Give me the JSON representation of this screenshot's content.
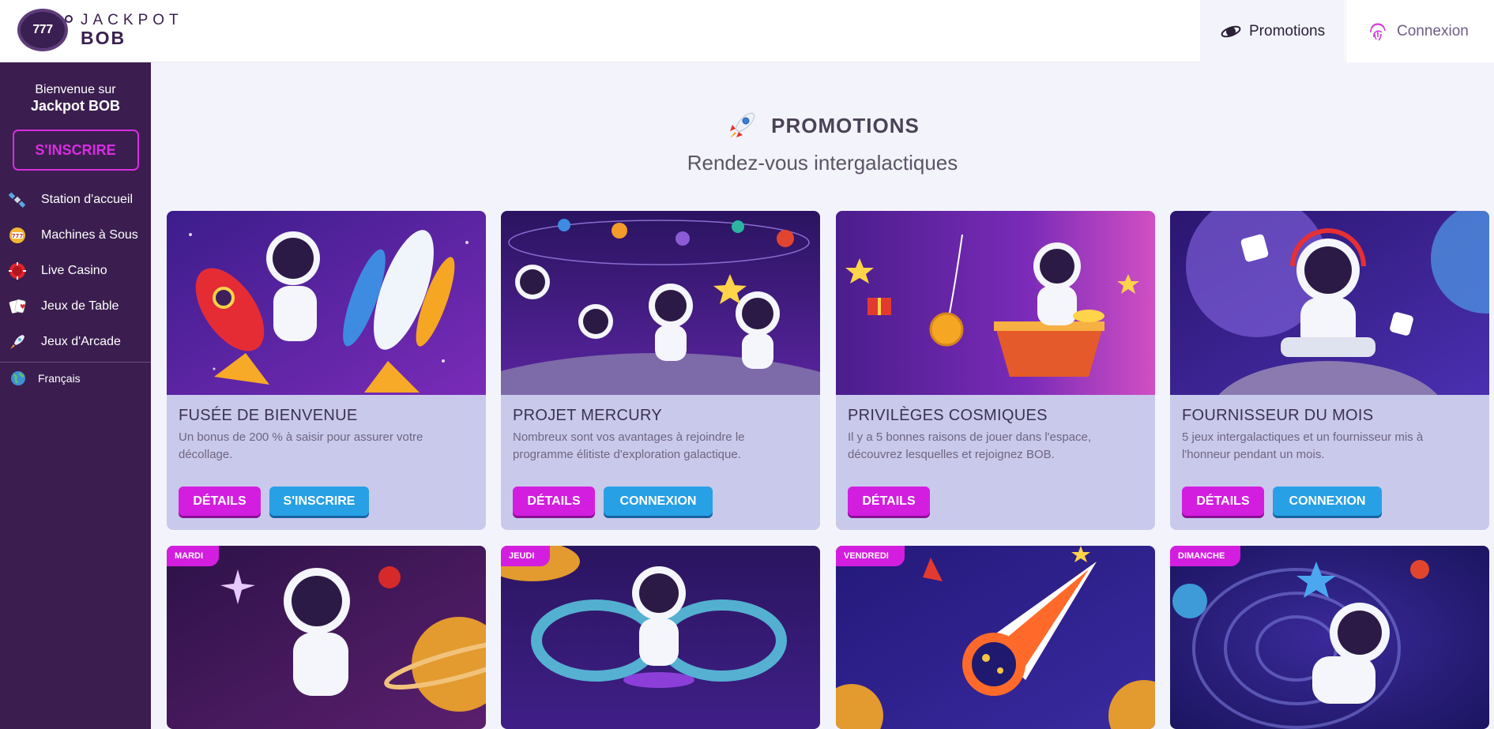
{
  "header": {
    "logo": {
      "top": "JACKPOT",
      "bottom": "BOB",
      "badge": "777"
    },
    "nav": {
      "promotions": "Promotions",
      "login": "Connexion"
    }
  },
  "sidebar": {
    "welcome_line": "Bienvenue sur",
    "welcome_brand": "Jackpot BOB",
    "signup": "S'INSCRIRE",
    "items": [
      {
        "label": "Station d'accueil",
        "icon": "satellite-icon"
      },
      {
        "label": "Machines à Sous",
        "icon": "slot-machine-icon"
      },
      {
        "label": "Live Casino",
        "icon": "casino-chip-icon"
      },
      {
        "label": "Jeux de Table",
        "icon": "playing-cards-icon"
      },
      {
        "label": "Jeux d'Arcade",
        "icon": "rocket-icon"
      }
    ],
    "language": "Français"
  },
  "main": {
    "title": "PROMOTIONS",
    "subtitle": "Rendez-vous intergalactiques",
    "cards": [
      {
        "title": "FUSÉE DE BIENVENUE",
        "desc": "Un bonus de 200 % à saisir pour assurer votre décollage.",
        "btn1": "DÉTAILS",
        "btn2": "S'INSCRIRE"
      },
      {
        "title": "PROJET MERCURY",
        "desc": "Nombreux sont vos avantages à rejoindre le programme élitiste d'exploration galactique.",
        "btn1": "DÉTAILS",
        "btn2": "CONNEXION"
      },
      {
        "title": "PRIVILÈGES COSMIQUES",
        "desc": "Il y a 5 bonnes raisons de jouer dans l'espace, découvrez lesquelles et rejoignez BOB.",
        "btn1": "DÉTAILS"
      },
      {
        "title": "FOURNISSEUR DU MOIS",
        "desc": "5 jeux intergalactiques et un fournisseur mis à l'honneur pendant un mois.",
        "btn1": "DÉTAILS",
        "btn2": "CONNEXION"
      }
    ],
    "day_cards": [
      {
        "day": "MARDI"
      },
      {
        "day": "JEUDI"
      },
      {
        "day": "VENDREDI"
      },
      {
        "day": "DIMANCHE"
      }
    ]
  },
  "colors": {
    "sidebar_bg": "#3b1e4f",
    "accent_pink": "#d31ee0",
    "accent_blue": "#27a0e6",
    "card_bg": "#c9c9ec",
    "page_bg": "#f3f4fb"
  }
}
